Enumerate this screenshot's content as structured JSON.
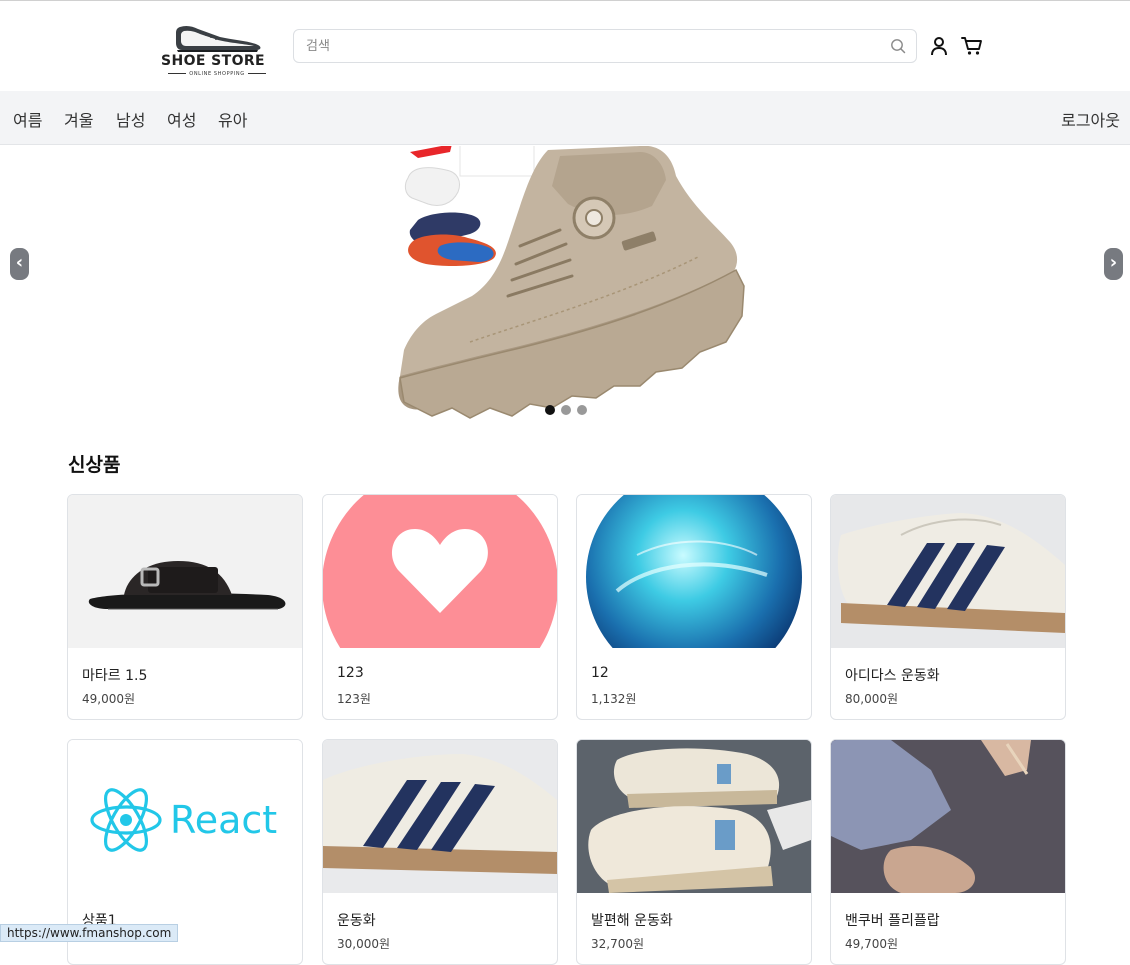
{
  "header": {
    "logo": {
      "title": "SHOE STORE",
      "subtitle": "ONLINE SHOPPING"
    },
    "search": {
      "placeholder": "검색",
      "value": ""
    }
  },
  "nav": {
    "items": [
      "여름",
      "겨울",
      "남성",
      "여성",
      "유아"
    ],
    "logout_label": "로그아웃"
  },
  "carousel": {
    "prev_label": "‹",
    "next_label": "›",
    "slide_count": 3,
    "active_slide": 1
  },
  "section": {
    "title": "신상품",
    "products": [
      {
        "name": "마타르 1.5",
        "price": "49,000원"
      },
      {
        "name": "123",
        "price": "123원"
      },
      {
        "name": "12",
        "price": "1,132원"
      },
      {
        "name": "아디다스 운동화",
        "price": "80,000원"
      },
      {
        "name": "상품1",
        "price": ""
      },
      {
        "name": "운동화",
        "price": "30,000원"
      },
      {
        "name": "발편해 운동화",
        "price": "32,700원"
      },
      {
        "name": "밴쿠버 플리플랍",
        "price": "49,700원"
      }
    ]
  },
  "react_logo_text": "React",
  "status_bar": {
    "url": "https://www.fmanshop.com"
  },
  "colors": {
    "nav_bg": "#f3f4f6",
    "heart_bg": "#fd8e96",
    "react_cyan": "#22c7e8"
  }
}
